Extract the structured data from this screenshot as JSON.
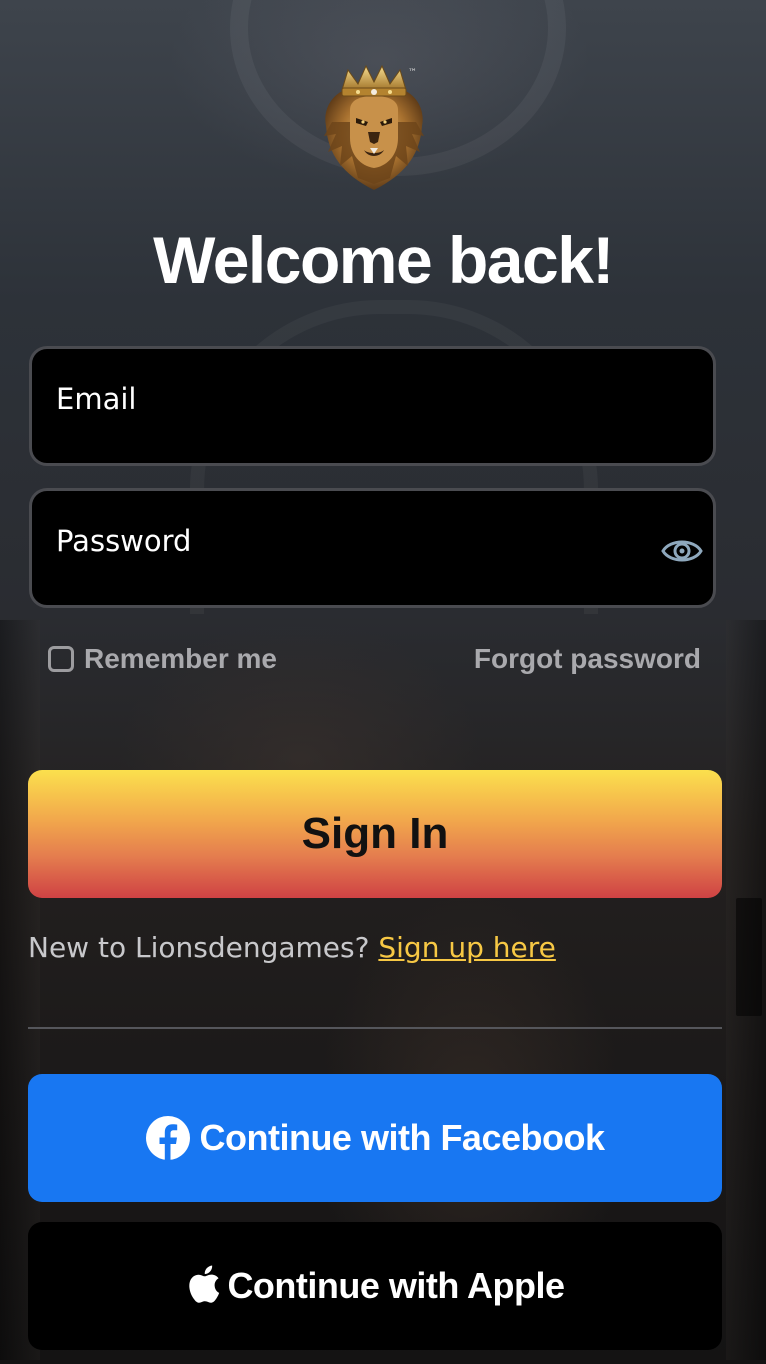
{
  "logo": {
    "icon": "lion-crown-logo",
    "trademark": "™"
  },
  "title": "Welcome back!",
  "form": {
    "email_placeholder": "Email",
    "password_placeholder": "Password",
    "password_toggle_icon": "eye-icon",
    "remember_label": "Remember me",
    "remember_checked": false,
    "forgot_label": "Forgot password"
  },
  "signin_label": "Sign In",
  "signup": {
    "prompt": "New to Lionsdengames?",
    "link": "Sign up here"
  },
  "social": {
    "facebook_label": "Continue with Facebook",
    "apple_label": "Continue with Apple"
  },
  "colors": {
    "facebook": "#1877f2",
    "link": "#f7c844",
    "signin_gradient": [
      "#fbe04d",
      "#e47c4e",
      "#cf4244"
    ]
  }
}
